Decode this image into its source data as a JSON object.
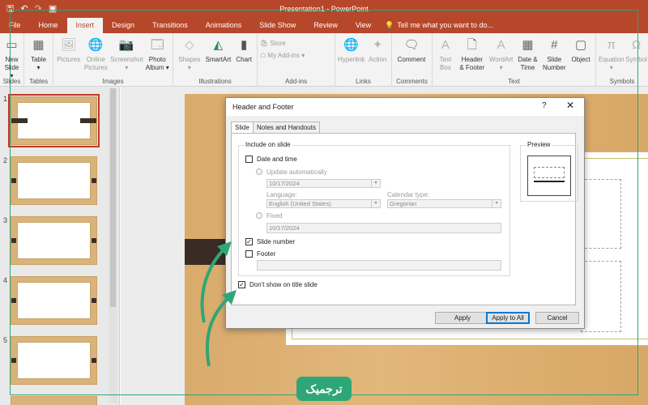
{
  "titlebar": {
    "title": "Presentation1 - PowerPoint",
    "qat": {
      "save_icon": "save-icon",
      "undo_icon": "undo-icon",
      "redo_icon": "redo-icon",
      "slideshow_icon": "slideshow-icon"
    }
  },
  "tabs": [
    "File",
    "Home",
    "Insert",
    "Design",
    "Transitions",
    "Animations",
    "Slide Show",
    "Review",
    "View"
  ],
  "active_tab": "Insert",
  "tell_me": "Tell me what you want to do...",
  "ribbon": {
    "slides": {
      "label": "Slides",
      "new_slide": "New",
      "new_slide_2": "Slide ▾"
    },
    "tables": {
      "label": "Tables",
      "table": "Table",
      "table_2": "▾"
    },
    "images": {
      "label": "Images",
      "pictures": "Pictures",
      "online_pictures": "Online",
      "online_pictures_2": "Pictures",
      "screenshot": "Screenshot",
      "screenshot_2": "▾",
      "photo_album": "Photo",
      "photo_album_2": "Album ▾"
    },
    "illustrations": {
      "label": "Illustrations",
      "shapes": "Shapes",
      "shapes_2": "▾",
      "smartart": "SmartArt",
      "chart": "Chart"
    },
    "addins": {
      "label": "Add-ins",
      "store": "Store",
      "my_addins": "My Add-ins",
      "my_addins_caret": "▾"
    },
    "links": {
      "label": "Links",
      "hyperlink": "Hyperlink",
      "action": "Action"
    },
    "comments": {
      "label": "Comments",
      "comment": "Comment"
    },
    "text": {
      "label": "Text",
      "text_box": "Text",
      "text_box_2": "Box",
      "header_footer": "Header",
      "header_footer_2": "& Footer",
      "wordart": "WordArt",
      "wordart_2": "▾",
      "date_time": "Date &",
      "date_time_2": "Time",
      "slide_number": "Slide",
      "slide_number_2": "Number",
      "object": "Object"
    },
    "symbols": {
      "label": "Symbols",
      "equation": "Equation",
      "equation_2": "▾",
      "symbol": "Symbol"
    }
  },
  "thumbnails": [
    "1",
    "2",
    "3",
    "4",
    "5"
  ],
  "dialog": {
    "title": "Header and Footer",
    "help": "?",
    "close": "✕",
    "tabs": [
      "Slide",
      "Notes and Handouts"
    ],
    "include_on_slide": "Include on slide",
    "date_time": {
      "label": "Date and time",
      "checked": false
    },
    "update_auto": {
      "label": "Update automatically",
      "value": "10/17/2024"
    },
    "language_label": "Language:",
    "language_value": "English (United States)",
    "calendar_label": "Calendar type:",
    "calendar_value": "Gregorian",
    "fixed": {
      "label": "Fixed",
      "value": "10/17/2024"
    },
    "slide_number": {
      "label": "Slide number",
      "checked": true
    },
    "footer": {
      "label": "Footer",
      "checked": false,
      "value": ""
    },
    "dont_show_title": {
      "label": "Don't show on title slide",
      "checked": true
    },
    "preview_label": "Preview",
    "buttons": {
      "apply": "Apply",
      "apply_all": "Apply to All",
      "cancel": "Cancel"
    }
  },
  "badge_text": "ترجمیک",
  "colors": {
    "accent": "#b7472a",
    "brand_green": "#2fa677"
  }
}
